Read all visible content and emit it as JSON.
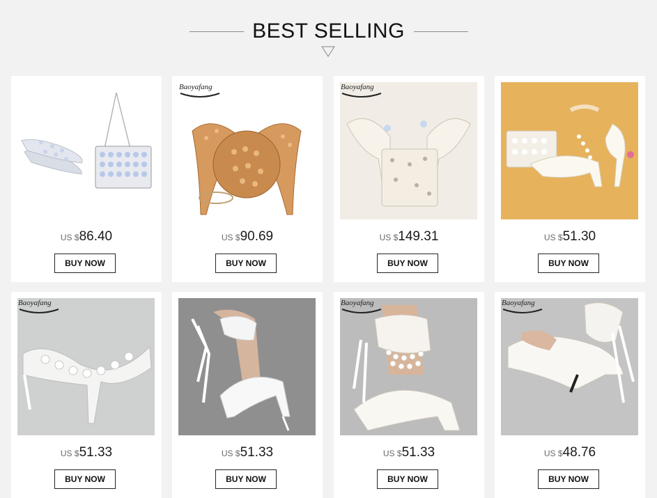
{
  "header": {
    "title": "BEST SELLING"
  },
  "products": [
    {
      "currency": "US $",
      "price": "86.40",
      "button": "BUY NOW",
      "brand": ""
    },
    {
      "currency": "US $",
      "price": "90.69",
      "button": "BUY NOW",
      "brand": "Baoyafang"
    },
    {
      "currency": "US $",
      "price": "149.31",
      "button": "BUY NOW",
      "brand": "Baoyafang"
    },
    {
      "currency": "US $",
      "price": "51.30",
      "button": "BUY NOW",
      "brand": ""
    },
    {
      "currency": "US $",
      "price": "51.33",
      "button": "BUY NOW",
      "brand": "Baoyafang"
    },
    {
      "currency": "US $",
      "price": "51.33",
      "button": "BUY NOW",
      "brand": ""
    },
    {
      "currency": "US $",
      "price": "51.33",
      "button": "BUY NOW",
      "brand": "Baoyafang"
    },
    {
      "currency": "US $",
      "price": "48.76",
      "button": "BUY NOW",
      "brand": "Baoyafang"
    }
  ],
  "colors": {
    "background": "#f2f2f2",
    "card": "#ffffff",
    "text": "#111111"
  }
}
